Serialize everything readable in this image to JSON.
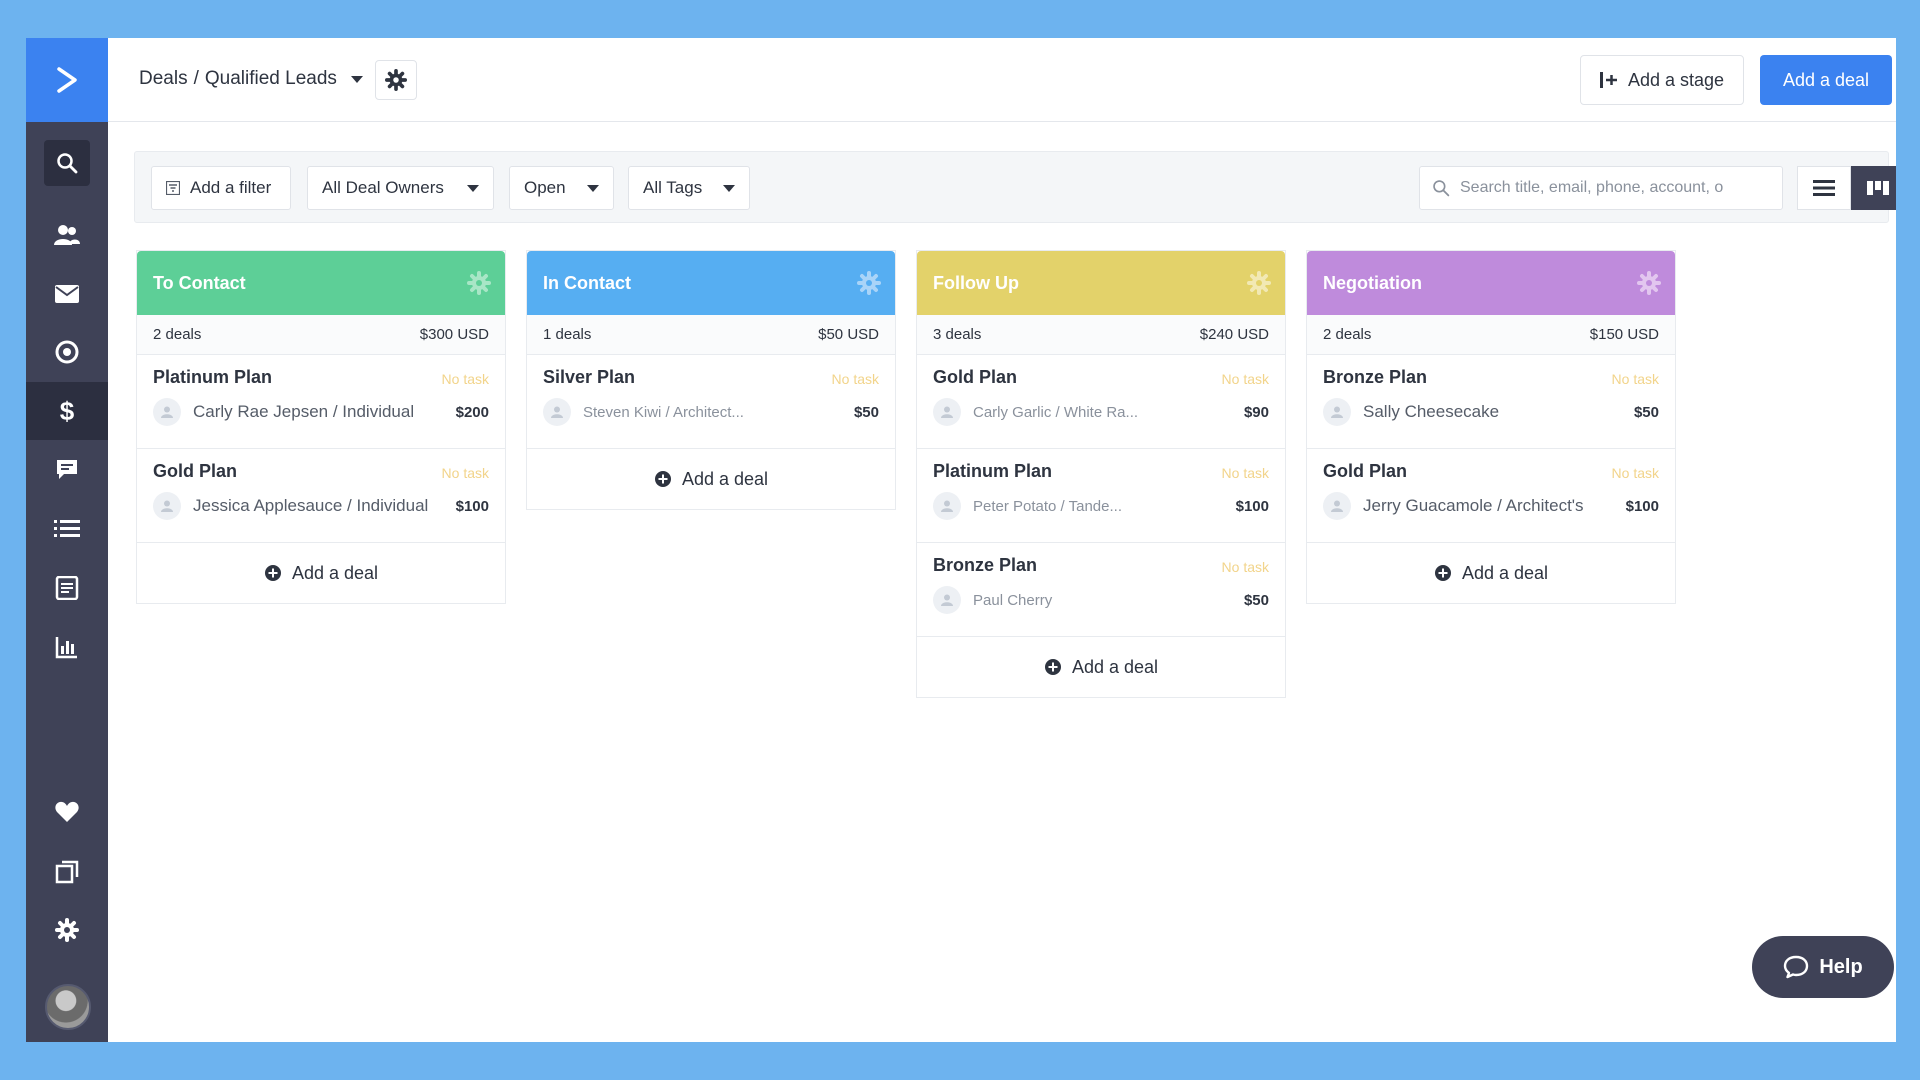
{
  "sidebar": {
    "items": [
      {
        "name": "search-icon"
      },
      {
        "name": "contacts-icon"
      },
      {
        "name": "mail-icon"
      },
      {
        "name": "automation-icon"
      },
      {
        "name": "dollar-icon"
      },
      {
        "name": "conversations-icon"
      },
      {
        "name": "lists-icon"
      },
      {
        "name": "forms-icon"
      },
      {
        "name": "reports-icon"
      },
      {
        "name": "heart-icon"
      },
      {
        "name": "pages-icon"
      },
      {
        "name": "gear-icon"
      }
    ]
  },
  "header": {
    "crumb_root": "Deals",
    "crumb_sep": "/",
    "pipeline": "Qualified Leads",
    "add_stage_label": "Add a stage",
    "add_deal_label": "Add a deal"
  },
  "filters": {
    "add_filter": "Add a filter",
    "owners": "All Deal Owners",
    "status": "Open",
    "tags": "All Tags",
    "search_placeholder": "Search title, email, phone, account, o"
  },
  "columns": [
    {
      "title": "To Contact",
      "color": "#5dcf97",
      "count": "2 deals",
      "total": "$300 USD",
      "deals": [
        {
          "title": "Platinum Plan",
          "task": "No task",
          "contact": "Carly Rae Jepsen / Individual",
          "amount": "$200"
        },
        {
          "title": "Gold Plan",
          "task": "No task",
          "contact": "Jessica Applesauce / Individual",
          "amount": "$100"
        }
      ],
      "add_label": "Add a deal"
    },
    {
      "title": "In Contact",
      "color": "#56aef2",
      "count": "1 deals",
      "total": "$50 USD",
      "deals": [
        {
          "title": "Silver Plan",
          "task": "No task",
          "contact": "Steven Kiwi / Architect...",
          "amount": "$50"
        }
      ],
      "add_label": "Add a deal"
    },
    {
      "title": "Follow Up",
      "color": "#e3d26a",
      "count": "3 deals",
      "total": "$240 USD",
      "deals": [
        {
          "title": "Gold Plan",
          "task": "No task",
          "contact": "Carly Garlic / White Ra...",
          "amount": "$90"
        },
        {
          "title": "Platinum Plan",
          "task": "No task",
          "contact": "Peter Potato / Tande...",
          "amount": "$100"
        },
        {
          "title": "Bronze Plan",
          "task": "No task",
          "contact": "Paul Cherry",
          "amount": "$50"
        }
      ],
      "add_label": "Add a deal"
    },
    {
      "title": "Negotiation",
      "color": "#bf8bdc",
      "count": "2 deals",
      "total": "$150 USD",
      "deals": [
        {
          "title": "Bronze Plan",
          "task": "No task",
          "contact": "Sally Cheesecake",
          "amount": "$50"
        },
        {
          "title": "Gold Plan",
          "task": "No task",
          "contact": "Jerry Guacamole / Architect's",
          "amount": "$100"
        }
      ],
      "add_label": "Add a deal"
    }
  ],
  "help_label": "Help"
}
